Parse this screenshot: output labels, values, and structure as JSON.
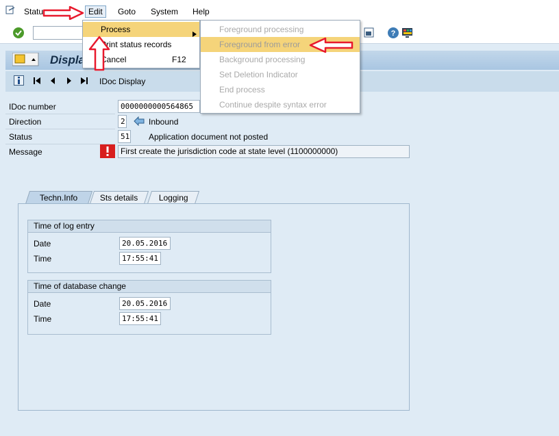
{
  "menubar": {
    "items": [
      "Status records",
      "Edit",
      "Goto",
      "System",
      "Help"
    ]
  },
  "edit_menu": {
    "items": [
      {
        "label": "Process",
        "shortcut": ""
      },
      {
        "label": "Print status records",
        "shortcut": ""
      },
      {
        "label": "Cancel",
        "shortcut": "F12"
      }
    ]
  },
  "process_submenu": {
    "items": [
      "Foreground processing",
      "Foreground from error",
      "Background processing",
      "Set Deletion Indicator",
      "End process",
      "Continue despite syntax error"
    ]
  },
  "title": {
    "text": "Display"
  },
  "app_toolbar": {
    "label": "IDoc Display"
  },
  "fields": {
    "idoc_number_label": "IDoc number",
    "idoc_number": "0000000000564865",
    "direction_label": "Direction",
    "direction_value": "2",
    "direction_text": "Inbound",
    "status_label": "Status",
    "status_value": "51",
    "status_text": "Application document not posted",
    "message_label": "Message",
    "message_text": "First create the jurisdiction code at state level (1100000000)"
  },
  "tabs": [
    "Techn.Info",
    "Sts details",
    "Logging"
  ],
  "log_entry": {
    "title": "Time of log entry",
    "date_label": "Date",
    "date": "20.05.2016",
    "time_label": "Time",
    "time": "17:55:41"
  },
  "db_change": {
    "title": "Time of database change",
    "date_label": "Date",
    "date": "20.05.2016",
    "time_label": "Time",
    "time": "17:55:41"
  },
  "colors": {
    "annotation_red": "#e8192c",
    "menu_highlight": "#f5d47a",
    "error_icon": "#d81e1e"
  }
}
